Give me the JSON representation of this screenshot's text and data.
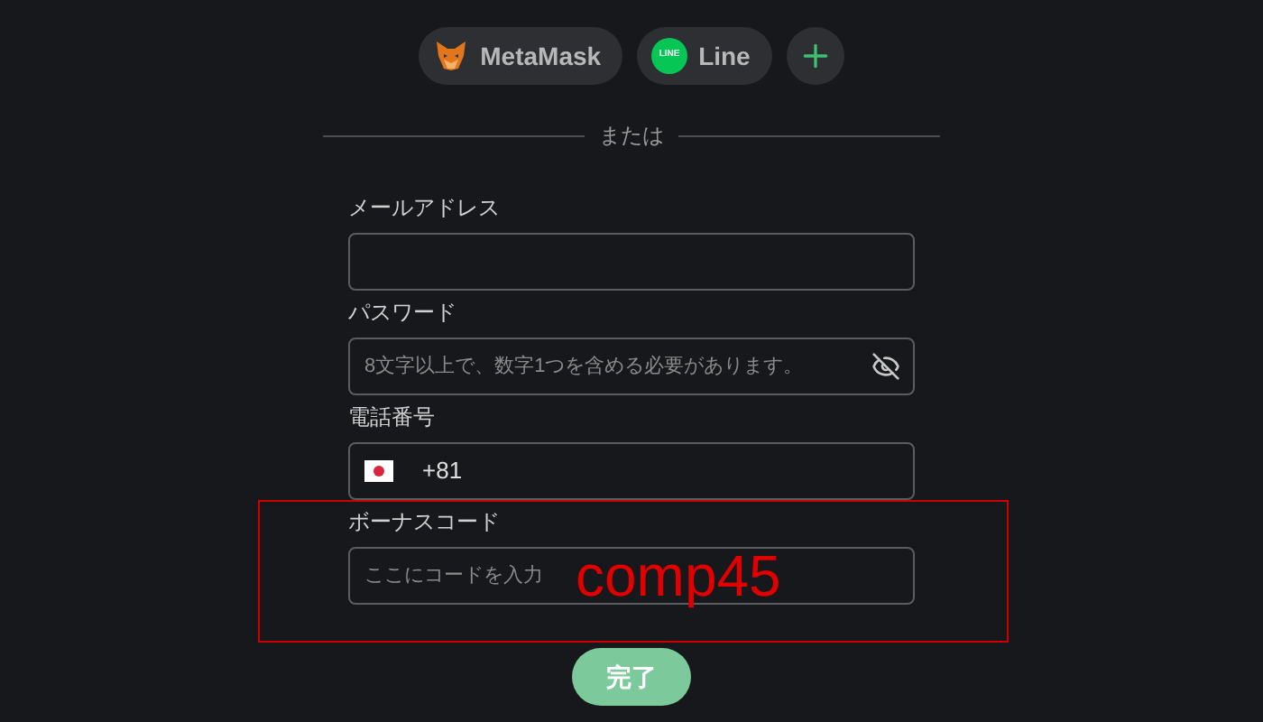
{
  "providers": [
    {
      "kind": "fox",
      "label": "MetaMask"
    },
    {
      "kind": "line",
      "label": "Line",
      "icon_text": "LINE"
    },
    {
      "kind": "more"
    }
  ],
  "divider": {
    "label": "または"
  },
  "fields": [
    {
      "kind": "text",
      "label": "メールアドレス"
    },
    {
      "kind": "password",
      "label": "パスワード",
      "placeholder": "8文字以上で、数字1つを含める必要があります。"
    },
    {
      "kind": "phone",
      "label": "電話番号",
      "value": "+81"
    },
    {
      "kind": "text",
      "label": "ボーナスコード",
      "placeholder": "ここにコードを入力",
      "annotation": "comp45"
    }
  ],
  "submit": {
    "label": "完了"
  }
}
